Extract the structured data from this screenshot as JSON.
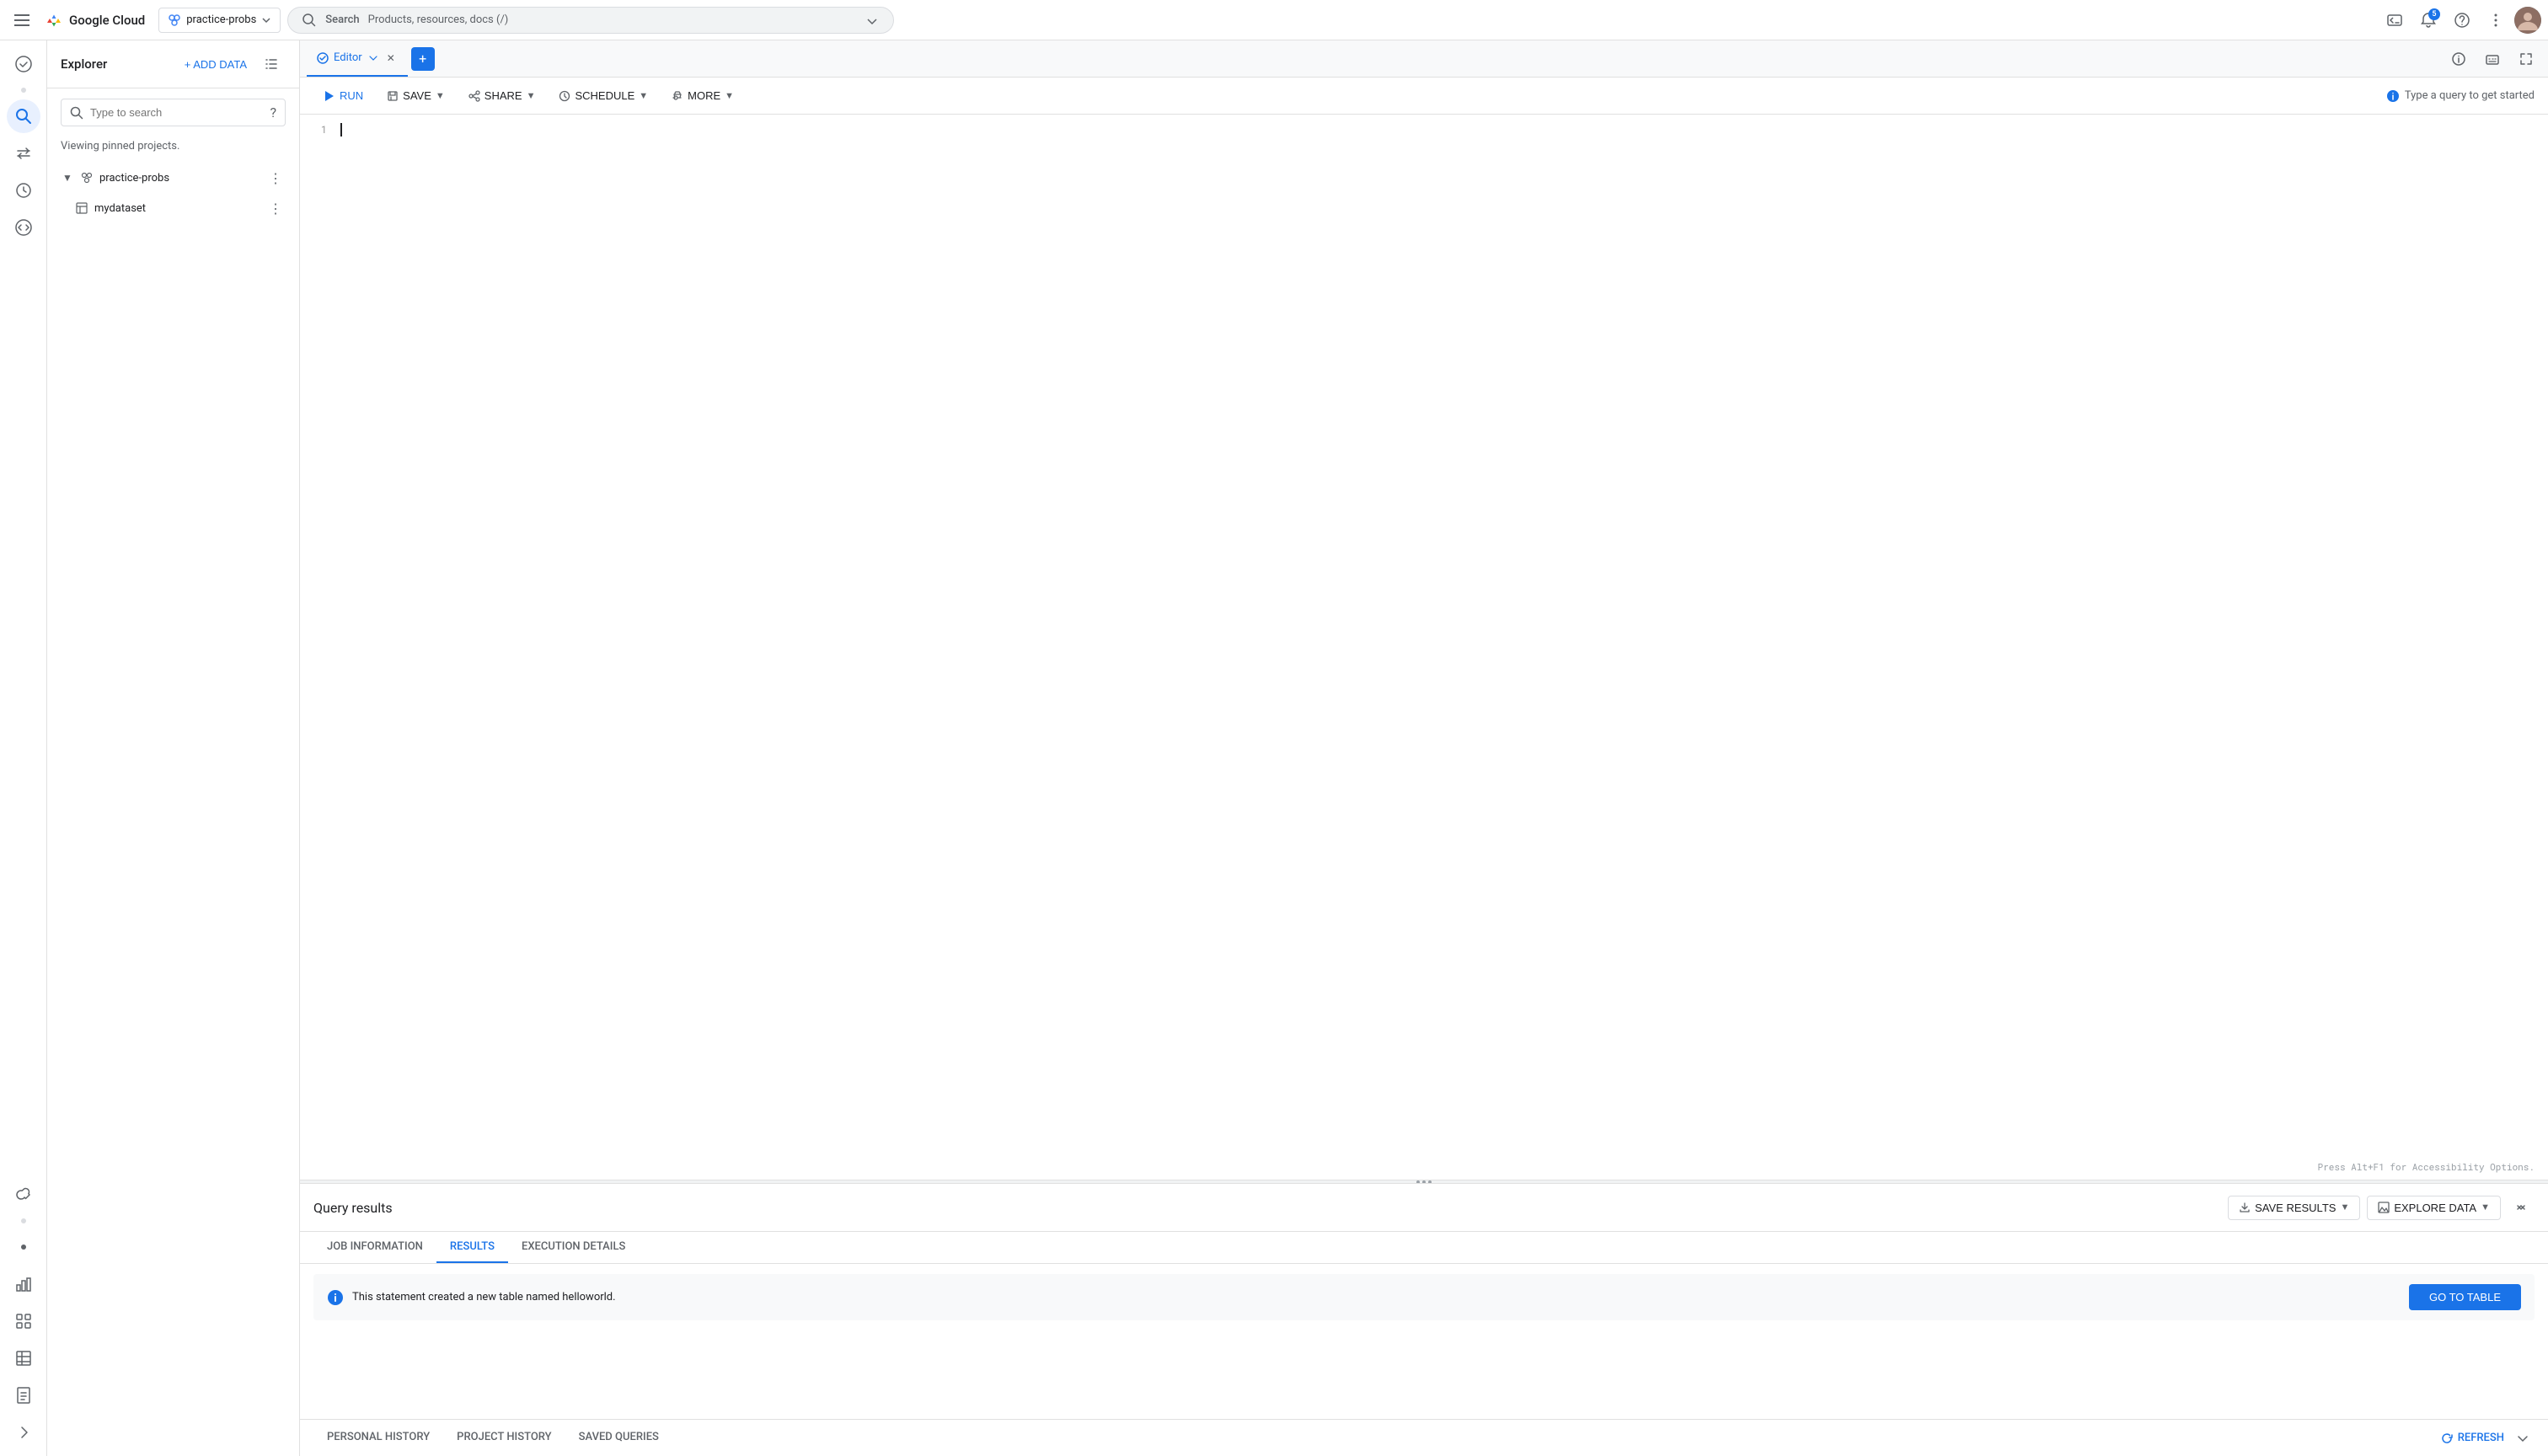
{
  "topnav": {
    "logo_text": "Google Cloud",
    "project_name": "practice-probs",
    "search_label": "Search",
    "search_placeholder": "Products, resources, docs (/)",
    "notification_count": "5"
  },
  "left_panel": {
    "title": "Explorer",
    "add_data_label": "+ ADD DATA",
    "search_placeholder": "Type to search",
    "viewing_text": "Viewing pinned projects.",
    "project_name": "practice-probs",
    "dataset_name": "mydataset"
  },
  "editor": {
    "tab_label": "Editor",
    "run_label": "RUN",
    "save_label": "SAVE",
    "share_label": "SHARE",
    "schedule_label": "SCHEDULE",
    "more_label": "MORE",
    "hint_text": "Type a query to get started",
    "line1": "",
    "accessibility_hint": "Press Alt+F1 for Accessibility Options."
  },
  "query_results": {
    "title": "Query results",
    "save_results_label": "SAVE RESULTS",
    "explore_data_label": "EXPLORE DATA",
    "tab_job_info": "JOB INFORMATION",
    "tab_results": "RESULTS",
    "tab_execution": "EXECUTION DETAILS",
    "info_text": "This statement created a new table named helloworld.",
    "go_to_table_label": "GO TO TABLE"
  },
  "bottom_tabs": {
    "personal_history": "PERSONAL HISTORY",
    "project_history": "PROJECT HISTORY",
    "saved_queries": "SAVED QUERIES",
    "refresh_label": "REFRESH"
  }
}
